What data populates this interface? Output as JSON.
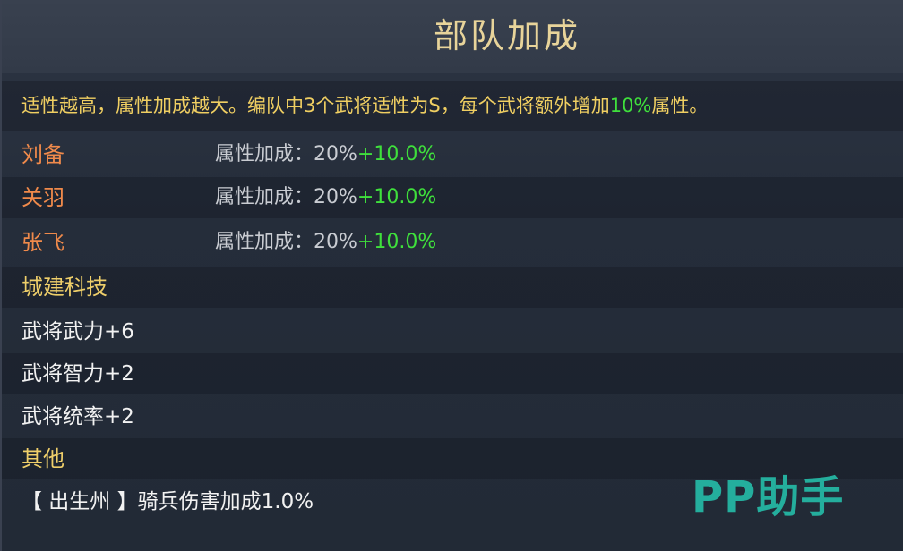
{
  "panel": {
    "title": "部队加成",
    "description_prefix": "适性越高，属性加成越大。编队中3个武将适性为S，每个武将额外增加",
    "description_highlight": "10%",
    "description_suffix": "属性。"
  },
  "generals": [
    {
      "name": "刘备",
      "bonus_label": "属性加成：",
      "bonus_value": "20%",
      "extra": "+10.0%"
    },
    {
      "name": "关羽",
      "bonus_label": "属性加成：",
      "bonus_value": "20%",
      "extra": "+10.0%"
    },
    {
      "name": "张飞",
      "bonus_label": "属性加成：",
      "bonus_value": "20%",
      "extra": "+10.0%"
    }
  ],
  "city_tech": {
    "heading": "城建科技",
    "items": [
      "武将武力+6",
      "武将智力+2",
      "武将统率+2"
    ]
  },
  "other": {
    "heading": "其他",
    "items": [
      "【 出生州 】骑兵伤害加成1.0%"
    ]
  },
  "watermark": "PP助手",
  "colors": {
    "title": "#e8d49a",
    "description": "#f0cf62",
    "highlight_green": "#3fe03c",
    "general_name": "#f08a4b",
    "section_heading": "#efcf6a",
    "watermark": "#25b6a3"
  }
}
